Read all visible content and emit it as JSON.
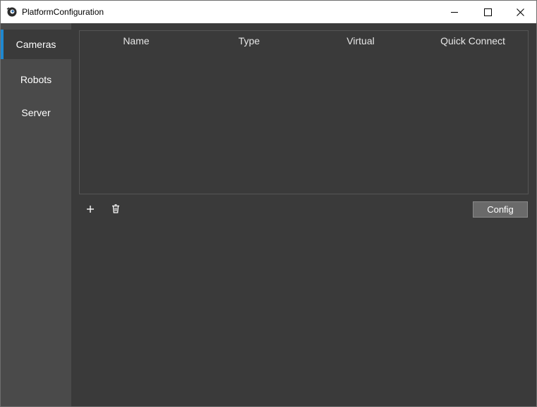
{
  "window": {
    "title": "PlatformConfiguration",
    "icon": "app-eye-icon",
    "controls": [
      "minimize-icon",
      "maximize-icon",
      "close-icon"
    ]
  },
  "sidebar": {
    "items": [
      {
        "label": "Cameras",
        "active": true
      },
      {
        "label": "Robots",
        "active": false
      },
      {
        "label": "Server",
        "active": false
      }
    ]
  },
  "table": {
    "columns": [
      "Name",
      "Type",
      "Virtual",
      "Quick Connect"
    ],
    "rows": []
  },
  "toolbar": {
    "add_icon": "plus-icon",
    "delete_icon": "trash-icon",
    "config_label": "Config"
  },
  "colors": {
    "accent": "#1e88d0",
    "background": "#3a3a3a",
    "sidebar": "#4a4a4a"
  }
}
